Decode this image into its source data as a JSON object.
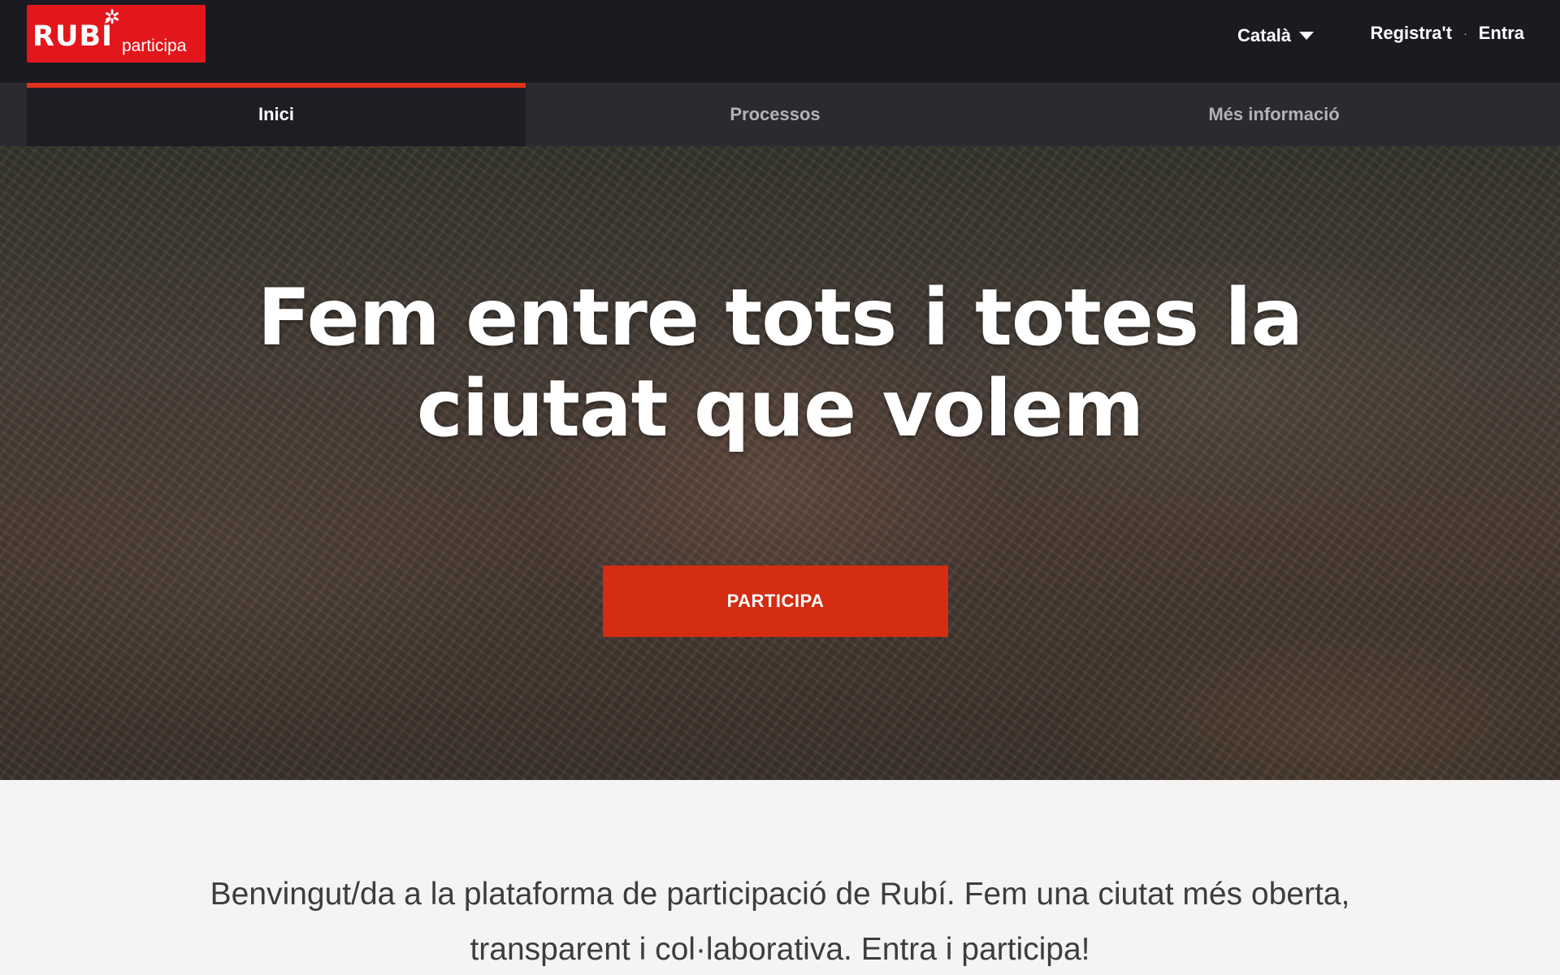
{
  "header": {
    "logo": {
      "main": "RUBÍ",
      "star": "✲",
      "sub": "participa"
    },
    "language": {
      "label": "Català",
      "icon": "caret-down-icon"
    },
    "auth": {
      "register": "Registra't",
      "separator": "·",
      "login": "Entra"
    }
  },
  "nav": {
    "tabs": [
      {
        "label": "Inici",
        "active": true
      },
      {
        "label": "Processos",
        "active": false
      },
      {
        "label": "Més informació",
        "active": false
      }
    ]
  },
  "hero": {
    "title_line1": "Fem entre tots i totes la",
    "title_line2": "ciutat que volem",
    "cta_label": "PARTICIPA"
  },
  "welcome": {
    "line1": "Benvingut/da a la plataforma de participació de Rubí. Fem una ciutat més oberta,",
    "line2": "transparent i col·laborativa. Entra i participa!"
  },
  "colors": {
    "topbar": "#1b1a20",
    "nav": "#2b2a30",
    "accent": "#d42d12",
    "logo": "#e3161c"
  }
}
